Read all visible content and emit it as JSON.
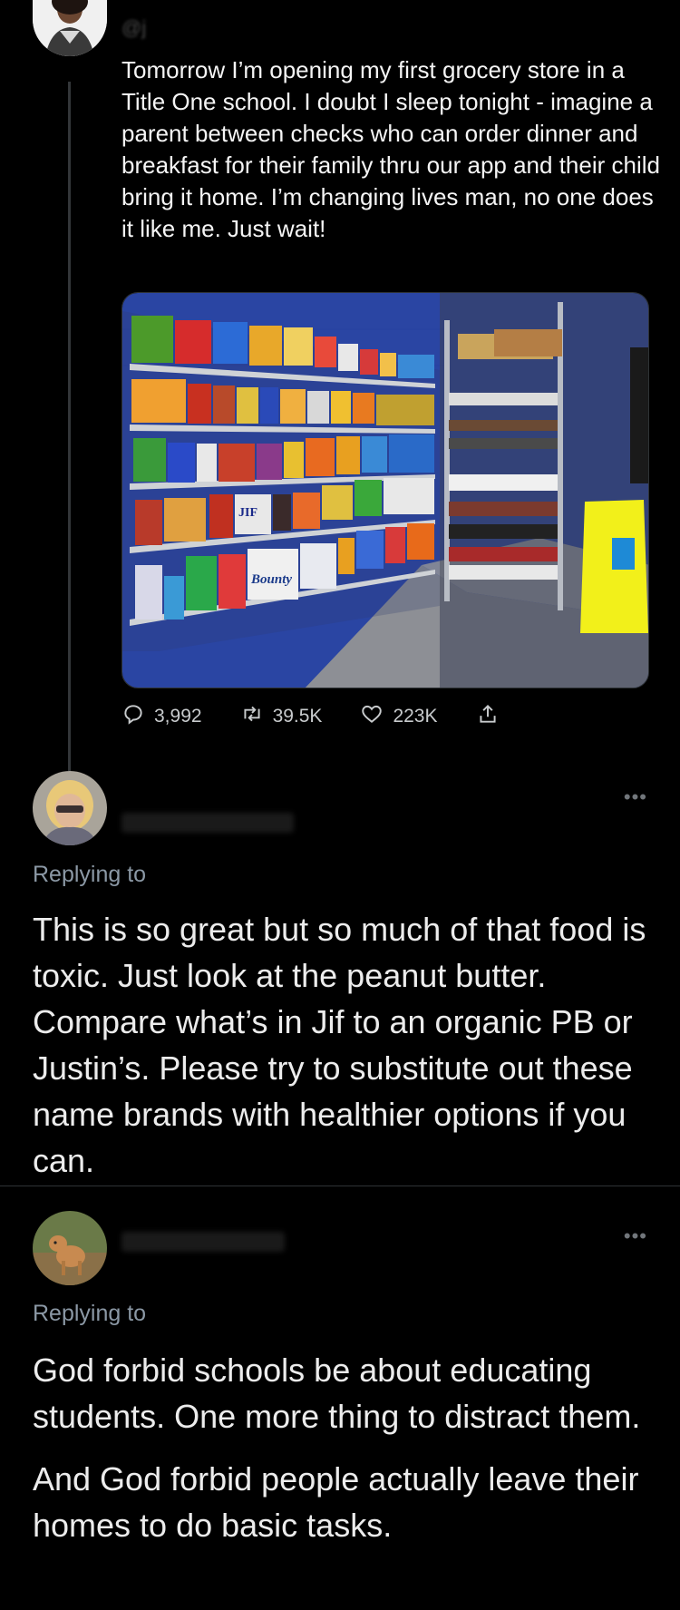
{
  "tweet": {
    "text": "Tomorrow I’m opening my first grocery store in a Title One school. I doubt I sleep tonight - imagine a parent between checks who can order dinner and breakfast for their family thru our app and their child bring it home. I’m changing lives man, no one does it like me. Just wait!",
    "handle_partial": "@j",
    "stats": {
      "replies": "3,992",
      "retweets": "39.5K",
      "likes": "223K"
    }
  },
  "reply1": {
    "replying_to": "Replying to",
    "text": "This is so great but so much of that food is toxic. Just look at the peanut butter. Compare what’s in Jif to an organic PB or Justin’s. Please try to substitute out these name brands with healthier options if you can.",
    "more": "•••"
  },
  "reply2": {
    "replying_to": "Replying to",
    "text_p1": "God forbid schools be about educating students. One more thing to distract them.",
    "text_p2": "And God forbid people actually leave their homes to do basic tasks.",
    "more": "•••"
  },
  "photo_labels": {
    "bounty": "Bounty",
    "jif": "JIF"
  },
  "icons": [
    "reply-icon",
    "retweet-icon",
    "like-icon",
    "share-icon"
  ],
  "colors": {
    "background": "#000000",
    "text": "#e7e9ea",
    "muted": "#8b98a5",
    "wall": "#2d4aa8"
  }
}
